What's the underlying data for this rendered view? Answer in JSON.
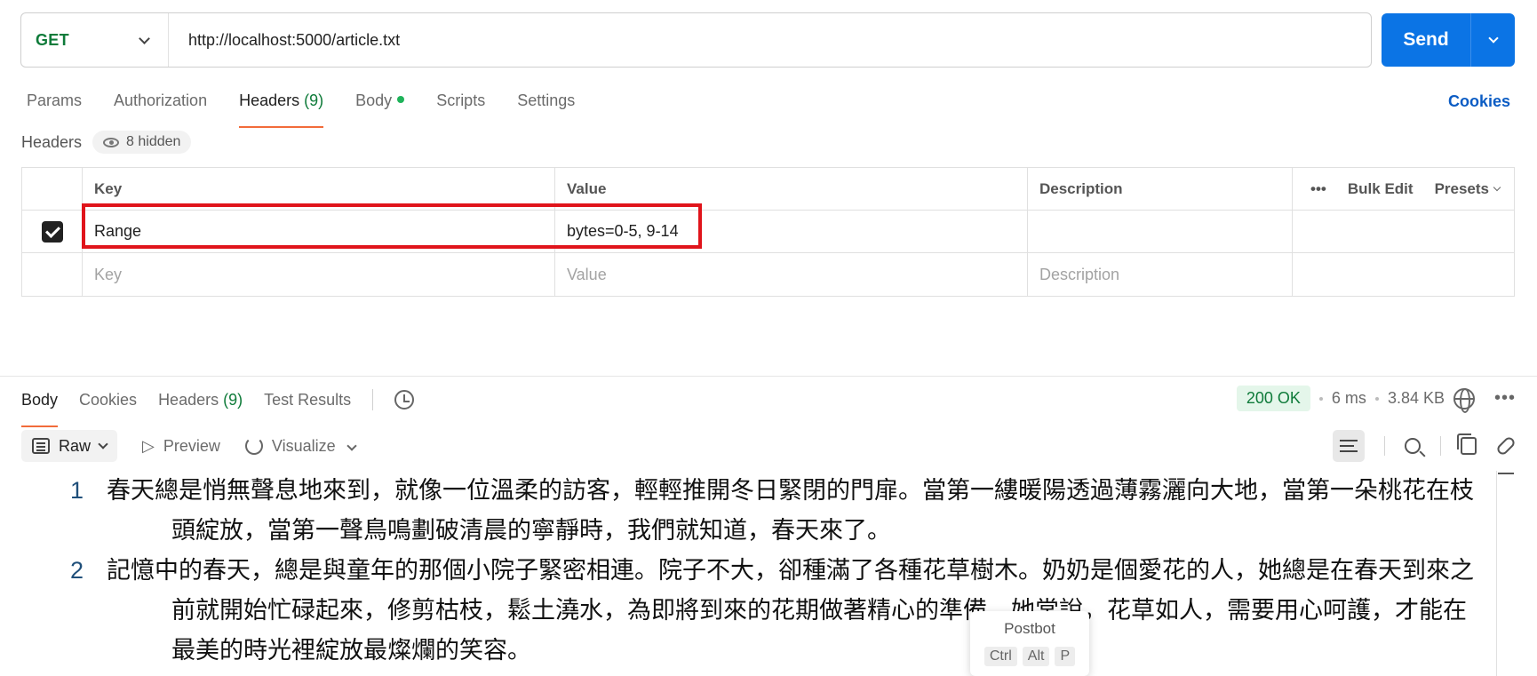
{
  "request": {
    "method": "GET",
    "url": "http://localhost:5000/article.txt",
    "send_label": "Send"
  },
  "tabs": [
    {
      "label": "Params"
    },
    {
      "label": "Authorization"
    },
    {
      "label": "Headers",
      "count": "(9)"
    },
    {
      "label": "Body"
    },
    {
      "label": "Scripts"
    },
    {
      "label": "Settings"
    }
  ],
  "cookies_label": "Cookies",
  "headers_section": {
    "title": "Headers",
    "hidden_label": "8 hidden",
    "columns": {
      "key": "Key",
      "value": "Value",
      "description": "Description"
    },
    "bulk_edit": "Bulk Edit",
    "presets": "Presets",
    "rows": [
      {
        "key": "Range",
        "value": "bytes=0-5, 9-14",
        "description": ""
      }
    ],
    "placeholders": {
      "key": "Key",
      "value": "Value",
      "description": "Description"
    }
  },
  "response": {
    "tabs": [
      {
        "label": "Body"
      },
      {
        "label": "Cookies"
      },
      {
        "label": "Headers",
        "count": "(9)"
      },
      {
        "label": "Test Results"
      }
    ],
    "status": "200 OK",
    "time": "6 ms",
    "size": "3.84 KB",
    "format_label": "Raw",
    "preview_label": "Preview",
    "visualize_label": "Visualize",
    "lines": [
      {
        "num": "1",
        "text": "春天總是悄無聲息地來到，就像一位溫柔的訪客，輕輕推開冬日緊閉的門扉。當第一縷暖陽透過薄霧灑向大地，當第一朵桃花在枝頭綻放，當第一聲鳥鳴劃破清晨的寧靜時，我們就知道，春天來了。"
      },
      {
        "num": "2",
        "text": "記憶中的春天，總是與童年的那個小院子緊密相連。院子不大，卻種滿了各種花草樹木。奶奶是個愛花的人，她總是在春天到來之前就開始忙碌起來，修剪枯枝，鬆土澆水，為即將到來的花期做著精心的準備。她常說，花草如人，需要用心呵護，才能在最美的時光裡綻放最燦爛的笑容。"
      }
    ]
  },
  "tooltip": {
    "title": "Postbot",
    "keys": [
      "Ctrl",
      "Alt",
      "P"
    ]
  },
  "colors": {
    "method": "#0f7b3a",
    "send": "#0b74e5",
    "active_tab_underline": "#f26b3a",
    "status_ok_bg": "#e4f6ea",
    "highlight": "#e0141b"
  }
}
